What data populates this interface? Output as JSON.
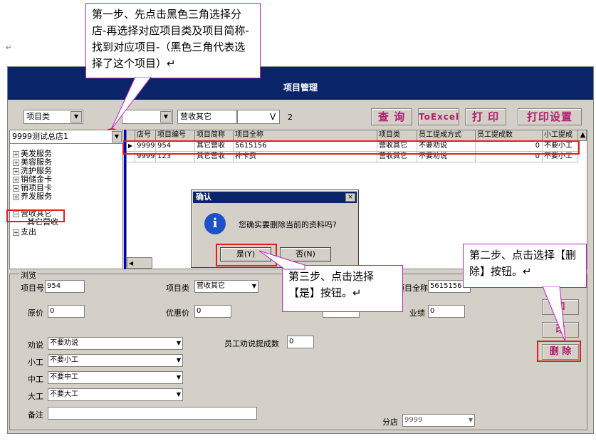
{
  "doc": {
    "para_marks": [
      "↵",
      "↵"
    ]
  },
  "window": {
    "title": "项目管理"
  },
  "toolbar": {
    "category_select": "项目类",
    "mid_select": "",
    "category_value": "营收其它",
    "v_label": "V",
    "page_num": "2",
    "query_btn": "查 询",
    "excel_btn": "ToExcel",
    "print_btn": "打 印",
    "print_setup_btn": "打印设置"
  },
  "branch_select": "9999测试总店1",
  "tree": {
    "items": [
      "美发服务",
      "美容服务",
      "洗护服务",
      "销储金卡",
      "销项目卡",
      "养发服务",
      "营收其它",
      "其它营收",
      "支出"
    ]
  },
  "grid": {
    "columns": [
      "店号",
      "项目编号",
      "项目简称",
      "项目全称",
      "项目类",
      "员工提成方式",
      "员工提成数",
      "小工提成"
    ],
    "rows": [
      [
        "9999",
        "954",
        "其它营收",
        "5615156",
        "营收其它",
        "不要劝说",
        "0",
        "不要小工"
      ],
      [
        "9999",
        "123",
        "其它营收",
        "补卡费",
        "营收其它",
        "不要劝说",
        "0",
        "不要小工"
      ]
    ]
  },
  "dialog": {
    "title": "确认",
    "close": "×",
    "message": "您确实要删除当前的资料吗?",
    "yes": "是(Y)",
    "no": "否(N)"
  },
  "form": {
    "group_label": "浏览",
    "item_no_label": "项目号",
    "item_no": "954",
    "category_label": "项目类",
    "category": "营收其它",
    "fullname_label": "项目全称",
    "fullname": "5615156",
    "price_label": "原价",
    "price": "0",
    "discount_label": "优惠价",
    "discount": "0",
    "perf_label": "业绩",
    "perf": "0",
    "persuade_label": "劝说",
    "persuade": "不要劝说",
    "staff_commission_label": "员工劝说提成数",
    "staff_commission": "0",
    "small_label": "小工",
    "small": "不要小工",
    "mid_label": "中工",
    "mid": "不要中工",
    "big_label": "大工",
    "big": "不要大工",
    "note_label": "备注",
    "note": "",
    "branch_label": "分店",
    "branch": "9999",
    "add_btn": "加",
    "edit_btn": "改",
    "delete_btn": "删 除"
  },
  "callouts": {
    "step1": "第一步、先点击黑色三角选择分店-再选择对应项目类及项目简称-找到对应项目-（黑色三角代表选择了这个项目）↵",
    "step2": "第二步、点击选择【删除】按钮。↵",
    "step3": "第三步、点击选择【是】按钮。↵"
  }
}
